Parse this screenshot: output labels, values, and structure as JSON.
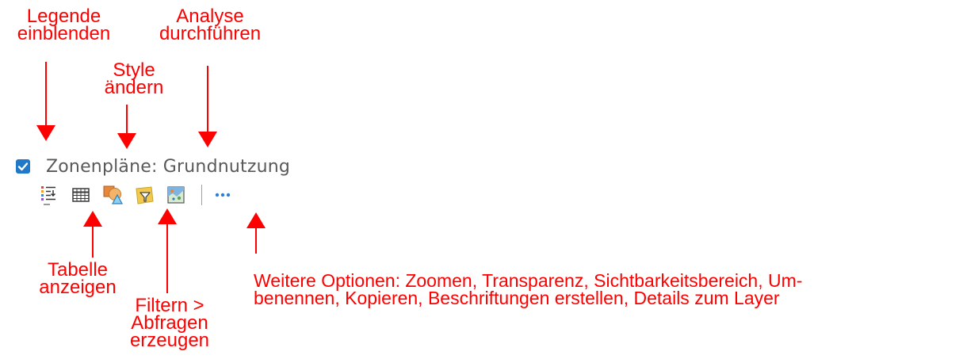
{
  "layer": {
    "title": "Zonenpläne: Grundnutzung",
    "visible": true
  },
  "toolbar": {
    "icons": [
      "legend-icon",
      "table-icon",
      "style-icon",
      "filter-icon",
      "analysis-icon",
      "more-options-icon"
    ]
  },
  "annotations": {
    "legend": [
      "Legende",
      "einblenden"
    ],
    "analysis": [
      "Analyse",
      "durchführen"
    ],
    "style": [
      "Style",
      "ändern"
    ],
    "table": [
      "Tabelle",
      "anzeigen"
    ],
    "filter": [
      "Filtern >",
      "Abfragen",
      "erzeugen"
    ],
    "more": [
      "Weitere Optionen: Zoomen, Transparenz, Sichtbarkeitsbereich, Um-",
      "benennen, Kopieren, Beschriftungen erstellen, Details zum Layer"
    ]
  },
  "colors": {
    "annotation": "#ff0000",
    "checkbox": "#1f78c8",
    "title_text": "#595959"
  }
}
